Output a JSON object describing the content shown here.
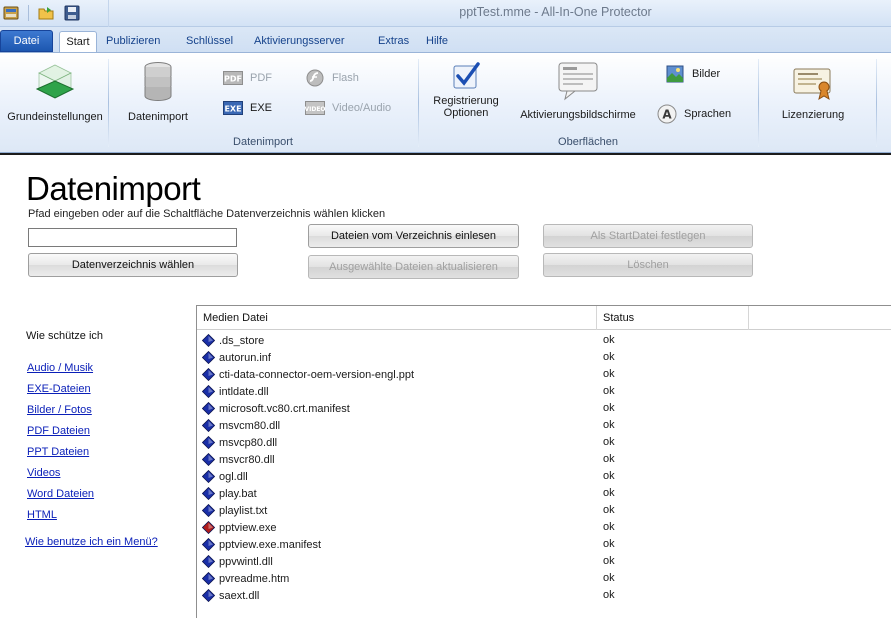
{
  "window": {
    "title": "pptTest.mme - All-In-One Protector"
  },
  "tabs": [
    {
      "label": "Datei"
    },
    {
      "label": "Start"
    },
    {
      "label": "Publizieren"
    },
    {
      "label": "Schlüssel"
    },
    {
      "label": "Aktivierungsserver"
    },
    {
      "label": "Extras"
    },
    {
      "label": "Hilfe"
    }
  ],
  "ribbon": {
    "grundeinstellungen": "Grundeinstellungen",
    "datenimport_btn": "Datenimport",
    "pdf": "PDF",
    "exe": "EXE",
    "flash": "Flash",
    "video_audio": "Video/Audio",
    "group_datenimport": "Datenimport",
    "registrierung_line1": "Registrierung",
    "registrierung_line2": "Optionen",
    "aktivierungsbildschirme": "Aktivierungsbildschirme",
    "bilder": "Bilder",
    "sprachen": "Sprachen",
    "group_oberflaechen": "Oberflächen",
    "lizenzierung": "Lizenzierung"
  },
  "main": {
    "title": "Datenimport",
    "hint": "Pfad eingeben oder auf die Schaltfläche Datenverzeichnis wählen klicken",
    "path_value": "",
    "btn_choose_dir": "Datenverzeichnis wählen",
    "btn_read_dir": "Dateien vom Verzeichnis einlesen",
    "btn_update_selected": "Ausgewählte Dateien aktualisieren",
    "btn_set_start": "Als StartDatei festlegen",
    "btn_delete": "Löschen"
  },
  "help": {
    "heading": "Wie schütze ich",
    "links": [
      "Audio / Musik",
      "EXE-Dateien",
      "Bilder / Fotos",
      "PDF Dateien",
      "PPT Dateien",
      "Videos",
      "Word Dateien",
      "HTML"
    ],
    "menu_link": "Wie benutze ich ein Menü?"
  },
  "table": {
    "columns": [
      "Medien Datei",
      "Status"
    ],
    "rows": [
      {
        "name": ".ds_store",
        "status": "ok",
        "icon": "file-icon"
      },
      {
        "name": "autorun.inf",
        "status": "ok",
        "icon": "file-icon"
      },
      {
        "name": "cti-data-connector-oem-version-engl.ppt",
        "status": "ok",
        "icon": "file-icon"
      },
      {
        "name": "intldate.dll",
        "status": "ok",
        "icon": "file-icon"
      },
      {
        "name": "microsoft.vc80.crt.manifest",
        "status": "ok",
        "icon": "file-icon"
      },
      {
        "name": "msvcm80.dll",
        "status": "ok",
        "icon": "file-icon"
      },
      {
        "name": "msvcp80.dll",
        "status": "ok",
        "icon": "file-icon"
      },
      {
        "name": "msvcr80.dll",
        "status": "ok",
        "icon": "file-icon"
      },
      {
        "name": "ogl.dll",
        "status": "ok",
        "icon": "file-icon"
      },
      {
        "name": "play.bat",
        "status": "ok",
        "icon": "file-icon"
      },
      {
        "name": "playlist.txt",
        "status": "ok",
        "icon": "file-icon"
      },
      {
        "name": "pptview.exe",
        "status": "ok",
        "icon": "start-file-icon"
      },
      {
        "name": "pptview.exe.manifest",
        "status": "ok",
        "icon": "file-icon"
      },
      {
        "name": "ppvwintl.dll",
        "status": "ok",
        "icon": "file-icon"
      },
      {
        "name": "pvreadme.htm",
        "status": "ok",
        "icon": "file-icon"
      },
      {
        "name": "saext.dll",
        "status": "ok",
        "icon": "file-icon"
      }
    ]
  },
  "colors": {
    "accent": "#1d57b0",
    "link": "#0a1fb8",
    "file_icon": "#1a2fa8",
    "start_file_icon": "#b01c1c"
  }
}
